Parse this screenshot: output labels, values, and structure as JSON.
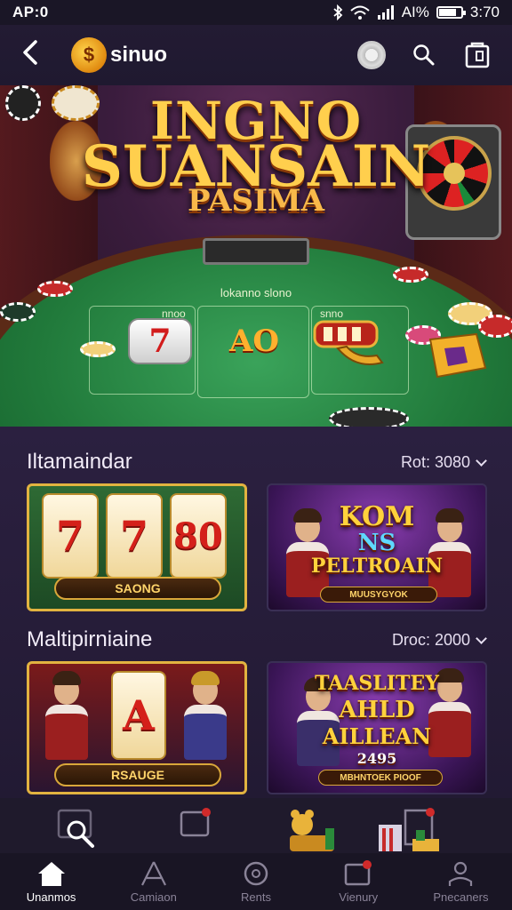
{
  "status_bar": {
    "time": "AP:0",
    "signal_text": "AI%",
    "clock": "3:70",
    "battery_level_percent": 80
  },
  "app_bar": {
    "brand_name": "sinuo",
    "brand_logo_glyph": "$"
  },
  "hero": {
    "title_line1": "INGNO",
    "title_line2": "SUANSAIN",
    "title_line3": "PASIMA",
    "felt_label": "lokanno slono",
    "zone_left_label": "nnoo",
    "zone_right_label": "snno",
    "zone_top_right_label": "",
    "seven_card": "7",
    "center_badge": "AO"
  },
  "sections": [
    {
      "title": "Iltamaindar",
      "meta": "Rot: 3080",
      "cards": [
        {
          "kind": "slot",
          "reels": [
            "7",
            "7",
            "80"
          ],
          "banner": "SAONG"
        },
        {
          "kind": "poster",
          "title_line1": "KOM",
          "title_line2": "NS",
          "title_line3": "PELTROAIN",
          "banner": "MUUSYGYOK"
        }
      ]
    },
    {
      "title": "Maltipirniaine",
      "meta": "Droc: 2000",
      "cards": [
        {
          "kind": "slot",
          "reels": [
            "",
            "A",
            ""
          ],
          "banner": "RSAUGE"
        },
        {
          "kind": "poster",
          "title_line1": "TAASLITEY",
          "title_line2": "AHLD",
          "title_line3": "AILLEAN",
          "extra": "2495",
          "banner": "MBHNTOEK PIOOF"
        }
      ]
    }
  ],
  "tabs": [
    {
      "label": "Unanmos",
      "icon": "home-icon",
      "active": true
    },
    {
      "label": "Camiaon",
      "icon": "triangle-a-icon",
      "active": false
    },
    {
      "label": "Rents",
      "icon": "circle-gear-icon",
      "active": false
    },
    {
      "label": "Vienury",
      "icon": "notification-box-icon",
      "active": false
    },
    {
      "label": "Pnecaners",
      "icon": "profile-icon",
      "active": false
    }
  ],
  "colors": {
    "accent": "#ffcf4d",
    "background": "#1b1629",
    "felt": "#217a3b",
    "badge": "#d02a2a"
  }
}
